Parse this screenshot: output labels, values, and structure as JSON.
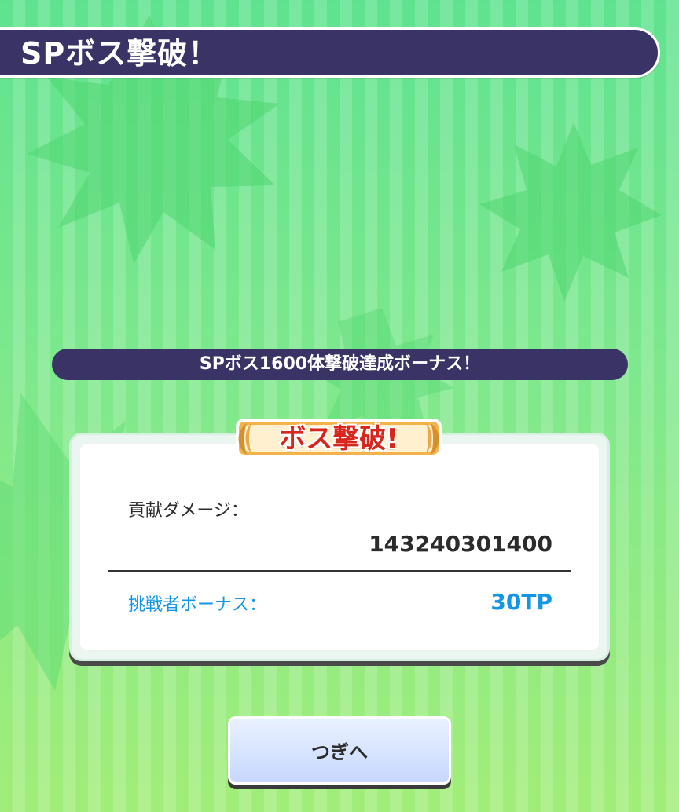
{
  "title_bar": {
    "text": "SPボス撃破！"
  },
  "bonus_banner": {
    "text": "SPボス1600体撃破達成ボーナス！"
  },
  "badge": {
    "text": "ボス撃破!"
  },
  "result_panel": {
    "damage_label": "貢献ダメージ：",
    "damage_value": "143240301400",
    "bonus_label": "挑戦者ボーナス：",
    "bonus_value": "30TP"
  },
  "next_button": {
    "label": "つぎへ"
  },
  "colors": {
    "navy": "#3a3466",
    "bonus_blue": "#1496e6",
    "badge_red": "#d9261d",
    "bg_green_top": "#5fe28f",
    "bg_green_bottom": "#a2ed79"
  }
}
